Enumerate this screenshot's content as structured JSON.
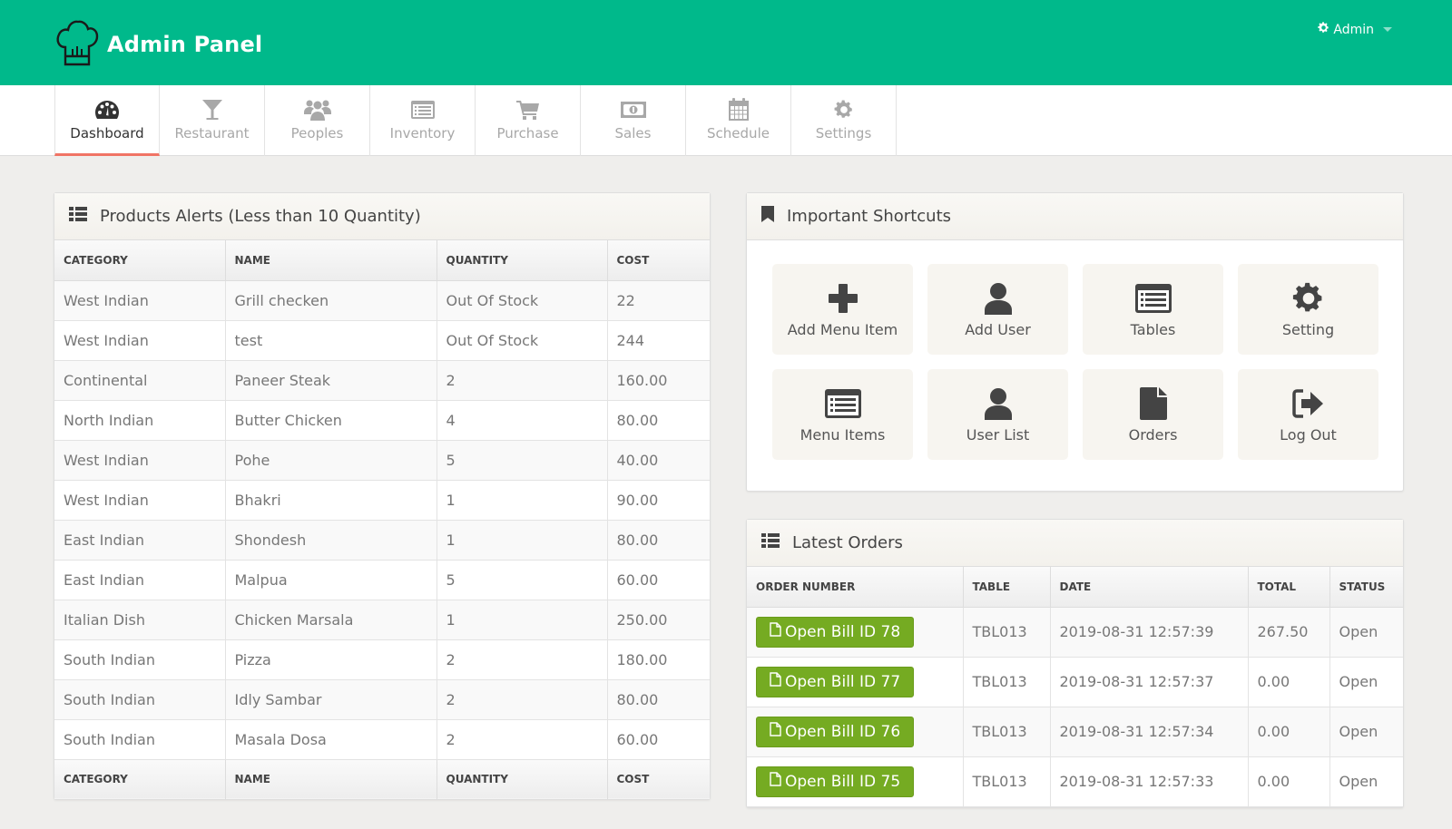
{
  "header": {
    "title": "Admin Panel",
    "user_label": "Admin",
    "brand_color": "#00b98b"
  },
  "nav": {
    "tabs": [
      {
        "label": "Dashboard",
        "icon": "dashboard-icon",
        "active": true
      },
      {
        "label": "Restaurant",
        "icon": "cocktail-glass-icon"
      },
      {
        "label": "Peoples",
        "icon": "users-icon"
      },
      {
        "label": "Inventory",
        "icon": "list-box-icon"
      },
      {
        "label": "Purchase",
        "icon": "cart-icon"
      },
      {
        "label": "Sales",
        "icon": "money-icon"
      },
      {
        "label": "Schedule",
        "icon": "calendar-icon"
      },
      {
        "label": "Settings",
        "icon": "gear-icon"
      }
    ]
  },
  "alerts": {
    "title": "Products Alerts (Less than 10 Quantity)",
    "columns": [
      "CATEGORY",
      "NAME",
      "QUANTITY",
      "COST"
    ],
    "rows": [
      [
        "West Indian",
        "Grill checken",
        "Out Of Stock",
        "22"
      ],
      [
        "West Indian",
        "test",
        "Out Of Stock",
        "244"
      ],
      [
        "Continental",
        "Paneer Steak",
        "2",
        "160.00"
      ],
      [
        "North Indian",
        "Butter Chicken",
        "4",
        "80.00"
      ],
      [
        "West Indian",
        "Pohe",
        "5",
        "40.00"
      ],
      [
        "West Indian",
        "Bhakri",
        "1",
        "90.00"
      ],
      [
        "East Indian",
        "Shondesh",
        "1",
        "80.00"
      ],
      [
        "East Indian",
        "Malpua",
        "5",
        "60.00"
      ],
      [
        "Italian Dish",
        "Chicken Marsala",
        "1",
        "250.00"
      ],
      [
        "South Indian",
        "Pizza",
        "2",
        "180.00"
      ],
      [
        "South Indian",
        "Idly Sambar",
        "2",
        "80.00"
      ],
      [
        "South Indian",
        "Masala Dosa",
        "2",
        "60.00"
      ]
    ]
  },
  "shortcuts": {
    "title": "Important Shortcuts",
    "items": [
      {
        "label": "Add Menu Item",
        "icon": "plus-icon"
      },
      {
        "label": "Add User",
        "icon": "user-icon"
      },
      {
        "label": "Tables",
        "icon": "list-box-icon"
      },
      {
        "label": "Setting",
        "icon": "gear-icon"
      },
      {
        "label": "Menu Items",
        "icon": "list-box-icon"
      },
      {
        "label": "User List",
        "icon": "user-icon"
      },
      {
        "label": "Orders",
        "icon": "file-icon"
      },
      {
        "label": "Log Out",
        "icon": "sign-out-icon"
      }
    ]
  },
  "orders": {
    "title": "Latest Orders",
    "columns": [
      "ORDER NUMBER",
      "TABLE",
      "DATE",
      "TOTAL",
      "STATUS"
    ],
    "rows": [
      {
        "button": "Open Bill ID 78",
        "table": "TBL013",
        "date": "2019-08-31 12:57:39",
        "total": "267.50",
        "status": "Open"
      },
      {
        "button": "Open Bill ID 77",
        "table": "TBL013",
        "date": "2019-08-31 12:57:37",
        "total": "0.00",
        "status": "Open"
      },
      {
        "button": "Open Bill ID 76",
        "table": "TBL013",
        "date": "2019-08-31 12:57:34",
        "total": "0.00",
        "status": "Open"
      },
      {
        "button": "Open Bill ID 75",
        "table": "TBL013",
        "date": "2019-08-31 12:57:33",
        "total": "0.00",
        "status": "Open"
      }
    ],
    "button_color": "#75ab22"
  }
}
